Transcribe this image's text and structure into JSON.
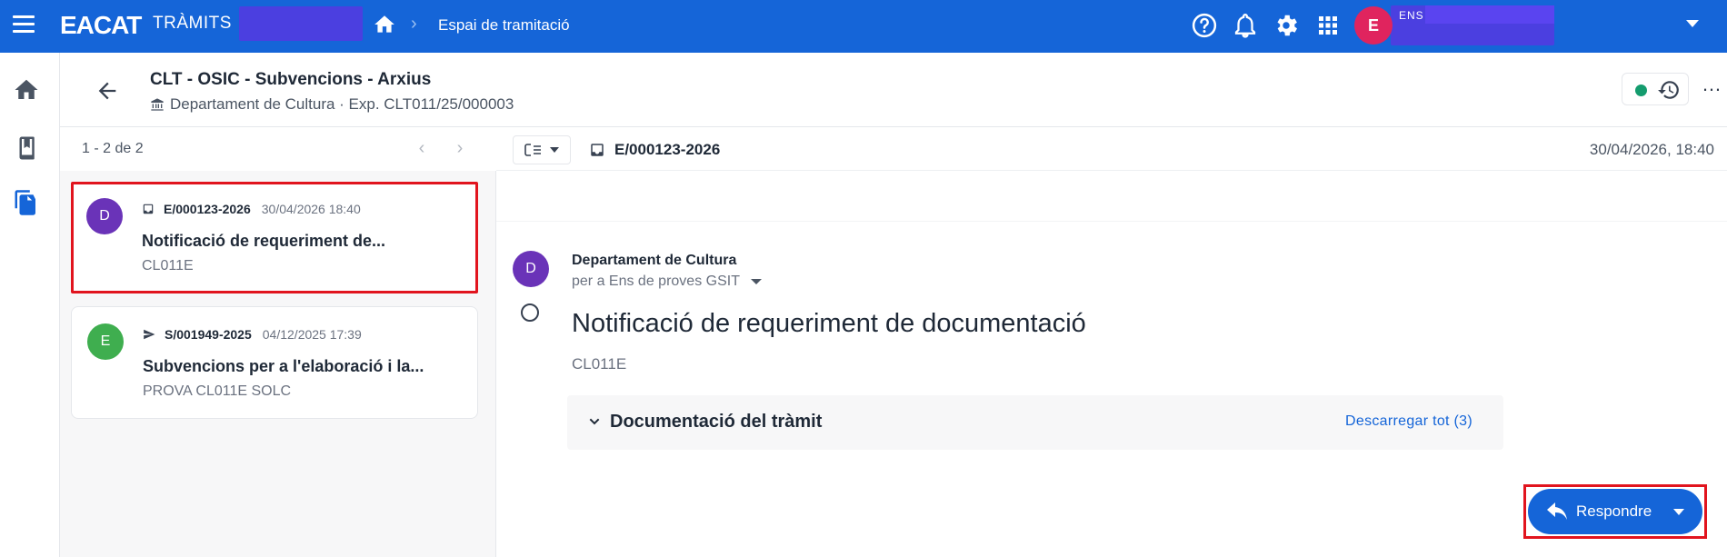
{
  "topbar": {
    "brand": "EACAT",
    "brand_sub": "TRÀMITS",
    "breadcrumb_current": "Espai de tramitació",
    "user_initial": "E",
    "user_org": "ENS",
    "icons": [
      "menu-icon",
      "home-icon",
      "help-icon",
      "bell-icon",
      "gear-icon",
      "apps-grid-icon",
      "chevron-down-icon"
    ]
  },
  "rail": {
    "items": [
      "home-icon",
      "book-icon",
      "documents-icon"
    ]
  },
  "header": {
    "title": "CLT - OSIC - Subvencions - Arxius",
    "subtitle": "Departament de Cultura · Exp. CLT011/25/000003",
    "status_color": "#149c6e"
  },
  "list": {
    "count": "1 - 2 de 2",
    "items": [
      {
        "initial": "D",
        "avatar_color": "#6a33b8",
        "icon": "inbox-icon",
        "ref": "E/000123-2026",
        "date": "30/04/2026 18:40",
        "title": "Notificació de requeriment de...",
        "code": "CL011E",
        "selected": true
      },
      {
        "initial": "E",
        "avatar_color": "#3fae4f",
        "icon": "send-icon",
        "ref": "S/001949-2025",
        "date": "04/12/2025 17:39",
        "title": "Subvencions per a l'elaboració i la...",
        "code": "PROVA CL011E SOLC",
        "selected": false
      }
    ]
  },
  "detail": {
    "ref": "E/000123-2026",
    "date": "30/04/2026, 18:40",
    "sender_initial": "D",
    "sender": "Departament de Cultura",
    "recipient": "per a Ens de proves GSIT",
    "title": "Notificació de requeriment de documentació",
    "code": "CL011E",
    "docs_title": "Documentació del tràmit",
    "docs_download": "Descarregar tot (3)",
    "reply_label": "Respondre"
  }
}
